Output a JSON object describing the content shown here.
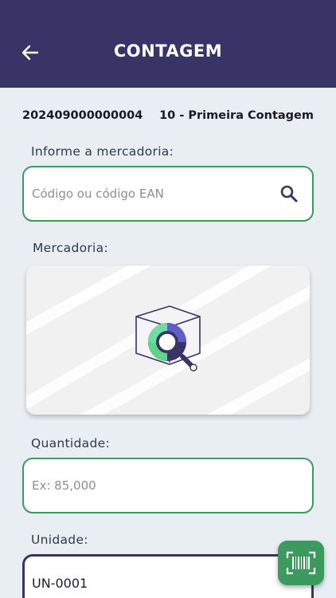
{
  "header": {
    "title": "CONTAGEM",
    "background": "#383566"
  },
  "count_info": {
    "code": "202409000000004",
    "stage": "10 - Primeira Contagem"
  },
  "product_search": {
    "label": "Informe a mercadoria:",
    "placeholder": "Código ou código EAN"
  },
  "product": {
    "label": "Mercadoria:",
    "image_icon": "box-search-icon"
  },
  "quantity": {
    "label": "Quantidade:",
    "placeholder": "Ex: 85,000"
  },
  "unit": {
    "label": "Unidade:",
    "value": "UN-0001"
  },
  "fab": {
    "icon": "barcode-scan-icon"
  },
  "colors": {
    "primary": "#383566",
    "accent_green": "#3c9a5f",
    "background": "#e9eef3"
  }
}
